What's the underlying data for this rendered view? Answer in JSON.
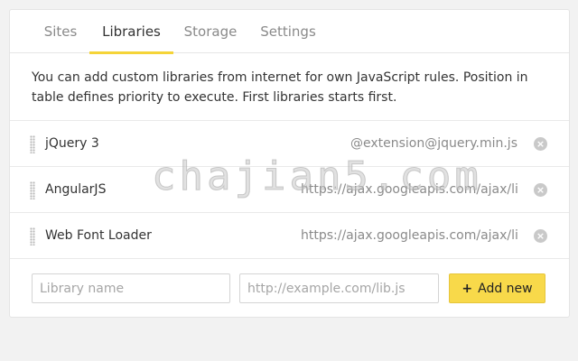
{
  "tabs": [
    {
      "label": "Sites"
    },
    {
      "label": "Libraries"
    },
    {
      "label": "Storage"
    },
    {
      "label": "Settings"
    }
  ],
  "active_tab": "Libraries",
  "description": "You can add custom libraries from internet for own JavaScript rules. Position in table defines priority to execute. First libraries starts first.",
  "libraries": [
    {
      "name": "jQuery 3",
      "url": "@extension@jquery.min.js"
    },
    {
      "name": "AngularJS",
      "url": "https://ajax.googleapis.com/ajax/libs/angularjs"
    },
    {
      "name": "Web Font Loader",
      "url": "https://ajax.googleapis.com/ajax/libs/webfont"
    }
  ],
  "add_form": {
    "name_placeholder": "Library name",
    "url_placeholder": "http://example.com/lib.js",
    "button_label": "Add new"
  },
  "watermark": "chajian5.com",
  "colors": {
    "accent": "#f5d438",
    "button": "#f8d94a"
  }
}
